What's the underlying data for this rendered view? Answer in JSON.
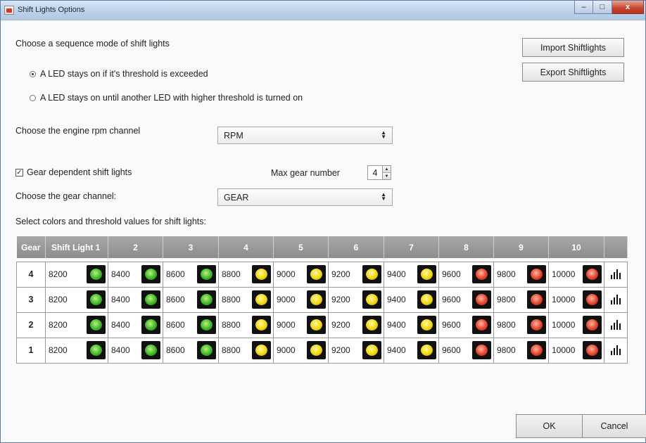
{
  "window": {
    "title": "Shift Lights Options",
    "controls": {
      "minimize": "–",
      "maximize": "□",
      "close": "x"
    }
  },
  "sequence": {
    "heading": "Choose a sequence mode of shift lights",
    "option1": "A LED stays on if it's threshold is exceeded",
    "option2": "A LED stays on until another LED with higher threshold is turned on",
    "selected": 1
  },
  "buttons": {
    "import": "Import Shiftlights",
    "export": "Export Shiftlights",
    "ok": "OK",
    "cancel": "Cancel"
  },
  "rpm": {
    "label": "Choose the engine rpm channel",
    "value": "RPM"
  },
  "gear": {
    "checkbox_label": "Gear dependent shift lights",
    "checked": true,
    "max_label": "Max gear number",
    "max_value": "4",
    "channel_label": "Choose the gear channel:",
    "channel_value": "GEAR"
  },
  "table": {
    "caption": "Select colors and threshold values for shift lights:",
    "headers": [
      "Gear",
      "Shift Light 1",
      "2",
      "3",
      "4",
      "5",
      "6",
      "7",
      "8",
      "9",
      "10"
    ],
    "led_colors": [
      "green",
      "green",
      "green",
      "yellow",
      "yellow",
      "yellow",
      "yellow",
      "red",
      "red",
      "red"
    ],
    "rows": [
      {
        "gear": "4",
        "values": [
          "8200",
          "8400",
          "8600",
          "8800",
          "9000",
          "9200",
          "9400",
          "9600",
          "9800",
          "10000"
        ]
      },
      {
        "gear": "3",
        "values": [
          "8200",
          "8400",
          "8600",
          "8800",
          "9000",
          "9200",
          "9400",
          "9600",
          "9800",
          "10000"
        ]
      },
      {
        "gear": "2",
        "values": [
          "8200",
          "8400",
          "8600",
          "8800",
          "9000",
          "9200",
          "9400",
          "9600",
          "9800",
          "10000"
        ]
      },
      {
        "gear": "1",
        "values": [
          "8200",
          "8400",
          "8600",
          "8800",
          "9000",
          "9200",
          "9400",
          "9600",
          "9800",
          "10000"
        ]
      }
    ],
    "row_icon": "bar-chart-icon"
  },
  "colors": {
    "led_green": "#3fb72a",
    "led_yellow": "#f2d80c",
    "led_red": "#e5442b",
    "header_gray": "#9a9a9a",
    "titlebar": "#bcd2ea"
  }
}
